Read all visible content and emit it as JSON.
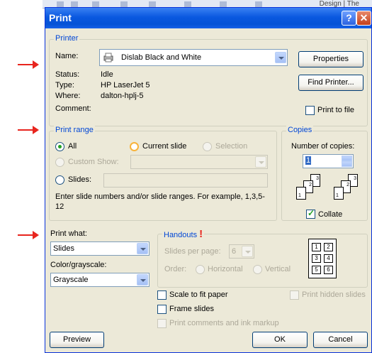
{
  "background_app": {
    "design_tab": "Design",
    "more_tab": "The"
  },
  "dialog": {
    "title": "Print",
    "help_glyph": "?",
    "close_glyph": "✕",
    "printer": {
      "legend": "Printer",
      "name_label": "Name:",
      "name_value": "Dislab Black and White",
      "properties_button": "Properties",
      "find_printer_button": "Find Printer...",
      "status_label": "Status:",
      "status_value": "Idle",
      "type_label": "Type:",
      "type_value": "HP LaserJet 5",
      "where_label": "Where:",
      "where_value": "dalton-hplj-5",
      "comment_label": "Comment:",
      "print_to_file": "Print to file"
    },
    "print_range": {
      "legend": "Print range",
      "all": "All",
      "current_slide": "Current slide",
      "selection": "Selection",
      "custom_show": "Custom Show:",
      "slides": "Slides:",
      "hint": "Enter slide numbers and/or slide ranges. For example, 1,3,5-12"
    },
    "copies": {
      "legend": "Copies",
      "number_label": "Number of copies:",
      "number_value": "1",
      "collate": "Collate"
    },
    "print_what": {
      "label": "Print what:",
      "value": "Slides"
    },
    "color": {
      "label": "Color/grayscale:",
      "value": "Grayscale"
    },
    "handouts": {
      "legend": "Handouts",
      "exclamation": "!",
      "per_page_label": "Slides per page:",
      "per_page_value": "6",
      "order_label": "Order:",
      "horizontal": "Horizontal",
      "vertical": "Vertical",
      "layout_numbers": [
        "1",
        "2",
        "3",
        "4",
        "5",
        "6"
      ]
    },
    "options": {
      "scale_to_fit": "Scale to fit paper",
      "frame_slides": "Frame slides",
      "print_comments": "Print comments and ink markup",
      "print_hidden": "Print hidden slides"
    },
    "buttons": {
      "preview": "Preview",
      "ok": "OK",
      "cancel": "Cancel"
    }
  },
  "colors": {
    "accent": "#0046d5",
    "title_bar": "#0553d6",
    "arrow": "#e8251e",
    "exclamation": "#e8251e"
  }
}
